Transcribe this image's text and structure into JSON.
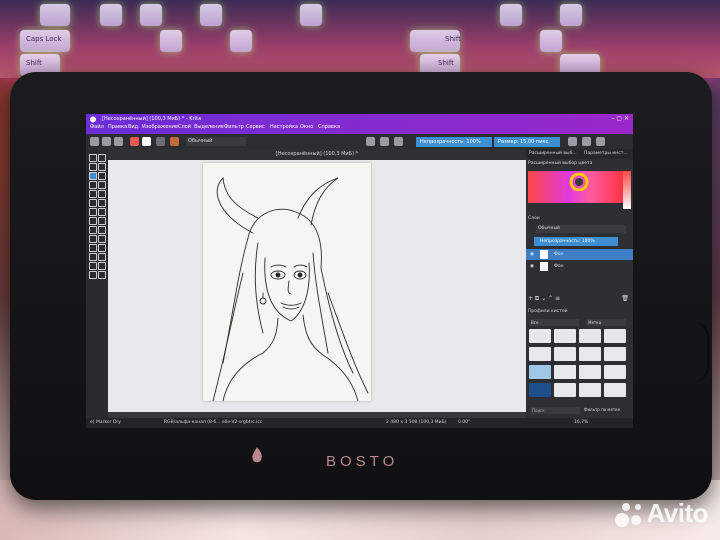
{
  "window": {
    "title": "[Несохранённый] (100,3 МиБ) * - Krita"
  },
  "menu": [
    "Файл",
    "Правка",
    "Вид",
    "Изображение",
    "Слой",
    "Выделение",
    "Фильтр",
    "Сервис",
    "Настройка",
    "Окно",
    "Справка"
  ],
  "toolbar": {
    "blend_mode": "Обычный",
    "opacity": "Непрозрачность: 100%",
    "size": "Размер: 15,00 пикс."
  },
  "document": {
    "tab_title": "[Несохранённый] (100,3 МиБ) *"
  },
  "dockers": {
    "tab_left": "Расширенный выб...",
    "tab_right": "Параметры инст...",
    "color_selector_title": "Расширенный выбор цвета",
    "layers_title": "Слои",
    "layer_blend_mode": "Обычный",
    "layer_opacity": "Непрозрачность: 100%",
    "layers": [
      {
        "name": "Фон",
        "active": true
      },
      {
        "name": "Фон",
        "active": false
      }
    ],
    "brush_presets_title": "Профили кистей",
    "brush_filter_all": "Все",
    "brush_tag": "Метка",
    "search_placeholder": "Поиск",
    "filter_by_tag": "Фильтр по метке"
  },
  "statusbar": {
    "brush": "e) Marker Dry",
    "color_profile": "RGB/альфа-канал (8-б... elle-V2-srgbtrc.icc",
    "image_size": "2 480 x 3 508 (100,3 МиБ)",
    "rotation": "0.00°",
    "zoom": "16,7%"
  },
  "device": {
    "brand": "BOSTO"
  },
  "keyboard": {
    "key_labels": [
      "Caps Lock",
      "Shift",
      "Shift",
      "Shift"
    ]
  },
  "watermark": {
    "text": "Avito"
  },
  "colors": {
    "krita_title_gradient": "#7b2be0",
    "field_blue": "#3d8fd1",
    "canvas_bg": "#e6e8ea",
    "bosto_text": "#b9878a"
  }
}
